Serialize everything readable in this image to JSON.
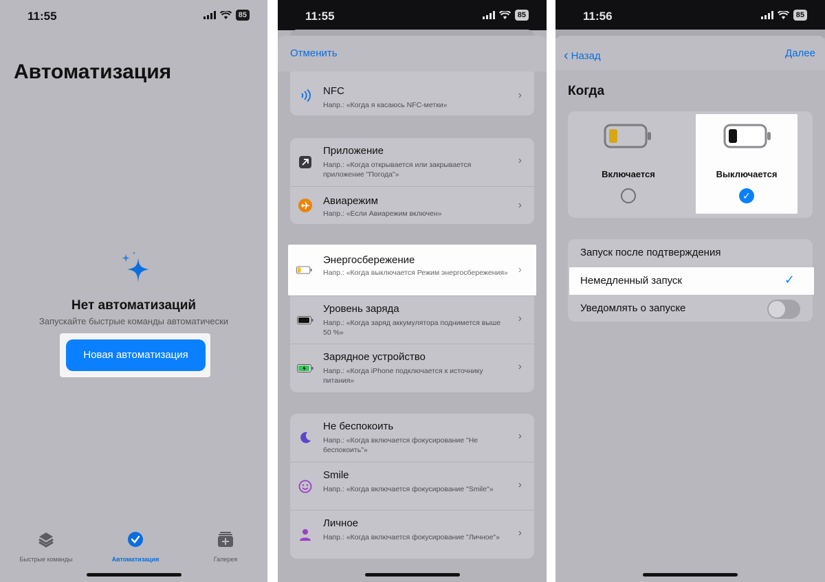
{
  "phone1": {
    "status": {
      "time": "11:55",
      "battery": "85"
    },
    "title": "Автоматизация",
    "empty": {
      "title": "Нет автоматизаций",
      "subtitle": "Запускайте быстрые команды автоматически"
    },
    "new_button": "Новая автоматизация",
    "tabs": [
      {
        "label": "Быстрые команды",
        "icon": "layers-icon"
      },
      {
        "label": "Автоматизация",
        "icon": "checkmark-clock-icon",
        "active": true
      },
      {
        "label": "Галерея",
        "icon": "gallery-icon"
      }
    ]
  },
  "phone2": {
    "status": {
      "time": "11:55",
      "battery": "85"
    },
    "cancel": "Отменить",
    "rows": [
      {
        "title": "NFC",
        "sub": "Напр.: «Когда я касаюсь NFC-метки»",
        "icon": "nfc-icon"
      },
      {
        "title": "Приложение",
        "sub": "Напр.: «Когда открывается или закрывается приложение \"Погода\"»",
        "icon": "app-arrow-icon"
      },
      {
        "title": "Авиарежим",
        "sub": "Напр.: «Если Авиарежим включен»",
        "icon": "airplane-icon"
      },
      {
        "title": "Энергосбережение",
        "sub": "Напр.: «Когда выключается Режим энергосбережения»",
        "icon": "low-power-battery-icon"
      },
      {
        "title": "Уровень заряда",
        "sub": "Напр.: «Когда заряд аккумулятора поднимется выше 50 %»",
        "icon": "battery-level-icon"
      },
      {
        "title": "Зарядное устройство",
        "sub": "Напр.: «Когда iPhone подключается к источнику питания»",
        "icon": "charging-battery-icon"
      },
      {
        "title": "Не беспокоить",
        "sub": "Напр.: «Когда включается фокусирование \"Не беспокоить\"»",
        "icon": "moon-icon"
      },
      {
        "title": "Smile",
        "sub": "Напр.: «Когда включается фокусирование \"Smile\"»",
        "icon": "smiley-icon"
      },
      {
        "title": "Личное",
        "sub": "Напр.: «Когда включается фокусирование \"Личное\"»",
        "icon": "person-icon"
      }
    ]
  },
  "phone3": {
    "status": {
      "time": "11:56",
      "battery": "85"
    },
    "back": "Назад",
    "next": "Далее",
    "section": "Когда",
    "options": [
      {
        "label": "Включается",
        "selected": false
      },
      {
        "label": "Выключается",
        "selected": true
      }
    ],
    "settings": {
      "confirm": "Запуск после подтверждения",
      "immediate": "Немедленный запуск",
      "notify": "Уведомлять о запуске",
      "notify_on": false
    }
  },
  "colors": {
    "accent": "#0a80ff",
    "low_power_yellow": "#f2c01b"
  }
}
